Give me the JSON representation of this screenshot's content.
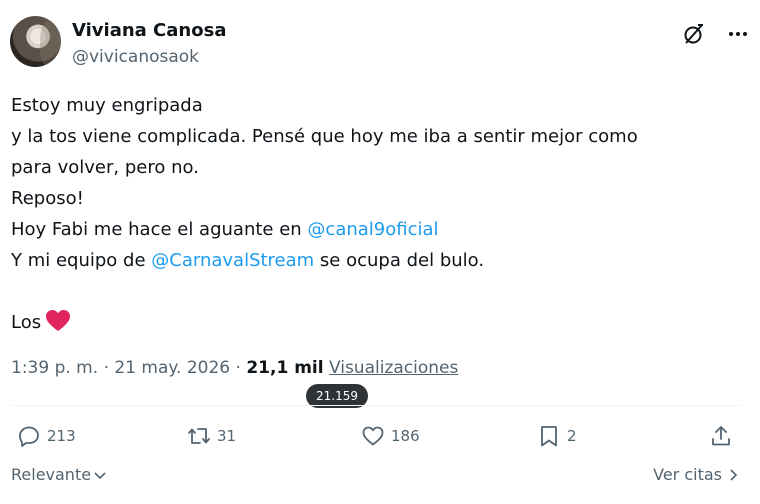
{
  "author": {
    "name": "Viviana Canosa",
    "handle": "@vivicanosaok"
  },
  "tweet": {
    "line1": "Estoy muy engripada",
    "line2": "y la tos viene complicada. Pensé que hoy me iba a sentir mejor como",
    "line3": "para volver, pero no.",
    "line4": "Reposo!",
    "line5_prefix": "Hoy Fabi me hace el aguante en ",
    "line5_mention": "@canal9oficial",
    "line6_prefix": "Y mi equipo de ",
    "line6_mention": "@CarnavalStream",
    "line6_suffix": " se ocupa del bulo.",
    "line7": "Los"
  },
  "meta": {
    "time": "1:39 p. m.",
    "separator": "·",
    "date": "21 may. 2026",
    "views_count": "21,1 mil",
    "views_label": "Visualizaciones",
    "tooltip": "21.159"
  },
  "actions": {
    "replies": "213",
    "reposts": "31",
    "likes": "186",
    "bookmarks": "2"
  },
  "footer": {
    "sort_label": "Relevante",
    "quotes_label": "Ver citas"
  },
  "icons": [
    "grok-icon",
    "more-icon",
    "reply-icon",
    "repost-icon",
    "like-icon",
    "bookmark-icon",
    "share-icon",
    "heart-emoji-icon",
    "chevron-down-icon",
    "chevron-right-icon"
  ],
  "colors": {
    "accent": "#1d9bf0",
    "text": "#0f1419",
    "muted": "#536471",
    "heart": "#e0245e"
  }
}
